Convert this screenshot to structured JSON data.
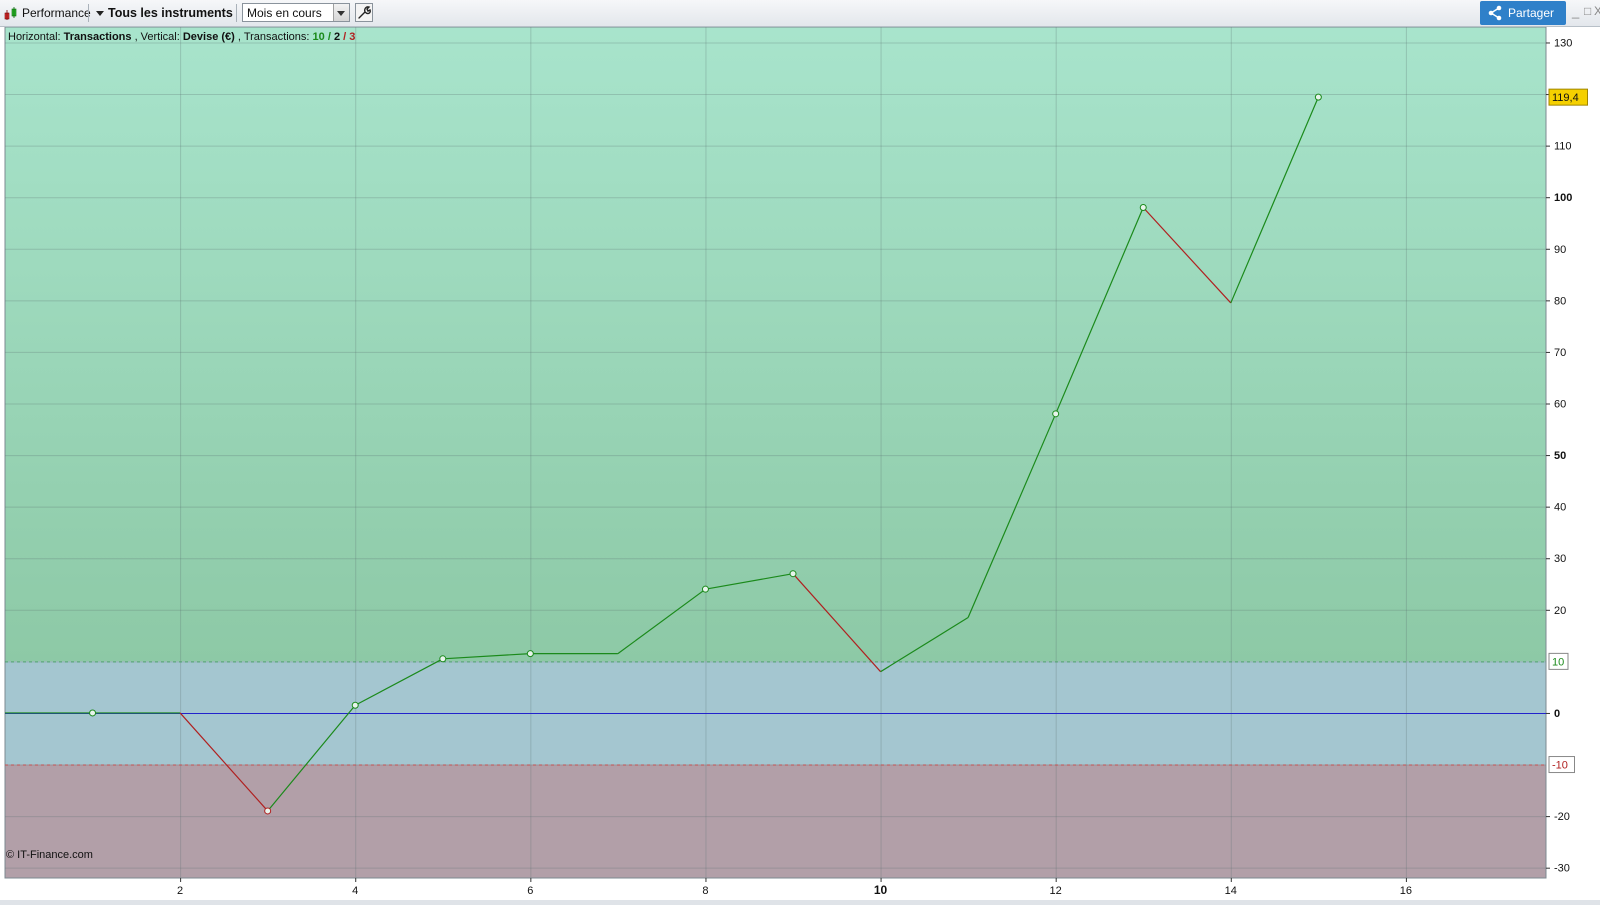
{
  "toolbar": {
    "performance_label": "Performance",
    "instruments_label": "Tous les instruments",
    "period_select": "Mois en cours",
    "share_label": "Partager",
    "window_controls": [
      "_",
      "□",
      "X"
    ]
  },
  "info": {
    "h_prefix": "Horizontal: ",
    "h_value": "Transactions",
    "v_prefix": ", Vertical: ",
    "v_value": "Devise (€)",
    "t_prefix": ", Transactions: ",
    "t_win": "10",
    "t_sep1": " / ",
    "t_neutral": "2",
    "t_sep2": " / ",
    "t_loss": "3"
  },
  "watermark": "© IT-Finance.com",
  "colors": {
    "up_zone_top": "#a8e4cc",
    "up_zone_bottom": "#8dc9a6",
    "mid_zone": "#a4c6d0",
    "down_zone": "#b29fa8",
    "line_up": "#1b8a1b",
    "line_down": "#b02020",
    "zero_line": "#2222cc",
    "last_value_bg": "#f5d000"
  },
  "chart_data": {
    "type": "line",
    "title": "",
    "xlabel": "Transactions",
    "ylabel": "Devise (€)",
    "xlim": [
      0,
      17.6
    ],
    "ylim": [
      -32,
      133
    ],
    "x_ticks": [
      2,
      4,
      6,
      8,
      10,
      12,
      14,
      16
    ],
    "y_ticks": [
      -30,
      -20,
      0,
      20,
      30,
      40,
      50,
      60,
      70,
      80,
      90,
      100,
      110,
      120,
      130
    ],
    "y_ticks_bold": [
      0,
      50,
      100
    ],
    "x_ticks_bold": [
      10
    ],
    "threshold_upper": 10,
    "threshold_lower": -10,
    "x": [
      0,
      1,
      2,
      3,
      4,
      5,
      6,
      7,
      8,
      9,
      10,
      11,
      12,
      13,
      14,
      15
    ],
    "y": [
      0,
      0,
      0,
      -19,
      1.5,
      10.5,
      11.5,
      11.5,
      24,
      27,
      8,
      18.5,
      58,
      98,
      79.5,
      119.4
    ],
    "markers": [
      1,
      3,
      4,
      5,
      6,
      8,
      9,
      12,
      13,
      15
    ],
    "last_value_label": "119,4",
    "upper_threshold_label": "10",
    "lower_threshold_label": "-10",
    "grid": true
  }
}
